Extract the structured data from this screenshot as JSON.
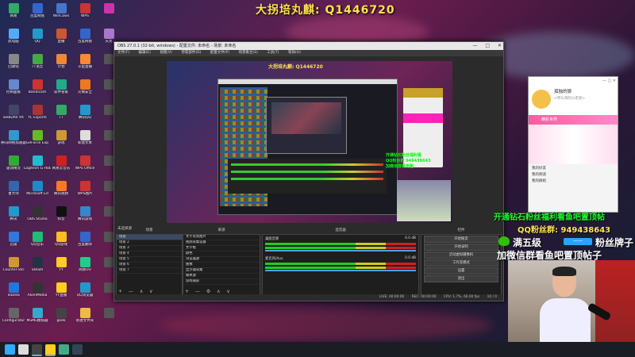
{
  "banner": "大拐培丸麒: Q1446720",
  "desktop_icons": [
    {
      "label": "网易",
      "color": "#3a6"
    },
    {
      "label": "百度网盘",
      "color": "#36c"
    },
    {
      "label": "WinCows",
      "color": "#47c"
    },
    {
      "label": "WPS",
      "color": "#c33"
    },
    {
      "label": "",
      "color": "#c3a"
    },
    {
      "label": "此电脑",
      "color": "#5af"
    },
    {
      "label": "QQ",
      "color": "#29c"
    },
    {
      "label": "直播",
      "color": "#c53"
    },
    {
      "label": "百度网盘",
      "color": "#36c"
    },
    {
      "label": "天龙",
      "color": "#a7c"
    },
    {
      "label": "回收站",
      "color": "#888"
    },
    {
      "label": "TT语音",
      "color": "#4a4"
    },
    {
      "label": "计划",
      "color": "#e83"
    },
    {
      "label": "斗鱼直播",
      "color": "#f83"
    },
    {
      "label": "",
      "color": "#555"
    },
    {
      "label": "控制面板",
      "color": "#68c"
    },
    {
      "label": "Bandicam",
      "color": "#c33"
    },
    {
      "label": "软件管家",
      "color": "#2a8"
    },
    {
      "label": "火绒安全",
      "color": "#e72"
    },
    {
      "label": "",
      "color": "#555"
    },
    {
      "label": "webDAV 9X",
      "color": "#446"
    },
    {
      "label": "YL Esports",
      "color": "#a33"
    },
    {
      "label": "TT",
      "color": "#3a6"
    },
    {
      "label": "腾讯QQ",
      "color": "#29c"
    },
    {
      "label": "",
      "color": "#555"
    },
    {
      "label": "腾讯网络加速器",
      "color": "#39c"
    },
    {
      "label": "GeForce Exp",
      "color": "#6b2"
    },
    {
      "label": "游戏",
      "color": "#c93"
    },
    {
      "label": "新建文本",
      "color": "#ddd"
    },
    {
      "label": "",
      "color": "#555"
    },
    {
      "label": "驱动精灵",
      "color": "#3a3"
    },
    {
      "label": "Logitech G HUB",
      "color": "#2bc"
    },
    {
      "label": "网易云音乐",
      "color": "#c22"
    },
    {
      "label": "WPS Office",
      "color": "#c33"
    },
    {
      "label": "",
      "color": "#555"
    },
    {
      "label": "鲁大师",
      "color": "#36a"
    },
    {
      "label": "Microsoft Ed",
      "color": "#28c"
    },
    {
      "label": "腾讯视频",
      "color": "#f72"
    },
    {
      "label": "WPS图片",
      "color": "#c33"
    },
    {
      "label": "",
      "color": "#555"
    },
    {
      "label": "腾讯",
      "color": "#29c"
    },
    {
      "label": "OBS Studio",
      "color": "#333"
    },
    {
      "label": "抖音",
      "color": "#111"
    },
    {
      "label": "腾讯游戏",
      "color": "#38c"
    },
    {
      "label": "",
      "color": "#555"
    },
    {
      "label": "迅雷",
      "color": "#37d"
    },
    {
      "label": "QQ音乐",
      "color": "#2b7"
    },
    {
      "label": "QQ游戏",
      "color": "#fb2"
    },
    {
      "label": "百度翻译",
      "color": "#36c"
    },
    {
      "label": "",
      "color": "#555"
    },
    {
      "label": "Counter-Stri",
      "color": "#c93"
    },
    {
      "label": "Steam",
      "color": "#234"
    },
    {
      "label": "YY",
      "color": "#fc2"
    },
    {
      "label": "网易UU",
      "color": "#2c8"
    },
    {
      "label": "",
      "color": "#555"
    },
    {
      "label": "ToDesk",
      "color": "#27d"
    },
    {
      "label": "AlienMedia",
      "color": "#333"
    },
    {
      "label": "YY直播",
      "color": "#fc2"
    },
    {
      "label": "QQ浏览器",
      "color": "#29c"
    },
    {
      "label": "",
      "color": "#555"
    },
    {
      "label": "Configurator",
      "color": "#666"
    },
    {
      "label": "MuMu模拟器",
      "color": "#3ac"
    },
    {
      "label": "geek",
      "color": "#444"
    },
    {
      "label": "新建文件夹",
      "color": "#eb4"
    },
    {
      "label": "",
      "color": "#555"
    }
  ],
  "obs": {
    "title": "OBS 27.0.1 (32-bit, windows) - 配置文件: 未命名 - 场景: 未命名",
    "window_controls": [
      "—",
      "□",
      "✕"
    ],
    "menu": [
      "文件(F)",
      "编辑(E)",
      "视图(V)",
      "停靠部件(D)",
      "配置文件(P)",
      "场景集合(S)",
      "工具(T)",
      "帮助(H)"
    ],
    "preview_banner": "大拐培丸麒: Q1446720",
    "preview_promo": [
      "开通钻石粉丝福利看",
      "QQ粉丝群 949438643",
      "加微信群看电脑"
    ],
    "preview_label": "未选择源",
    "docks": {
      "scenes": {
        "title": "场景",
        "items": [
          "场景",
          "场景 2",
          "场景 3",
          "场景 4",
          "场景 5",
          "场景 6",
          "场景 7"
        ],
        "selected": 0,
        "footer": "+ — ∧ ∨"
      },
      "sources": {
        "title": "来源",
        "items": [
          "文字背景图片",
          "视频采集设备",
          "文字框",
          "颜色",
          "浏览器源",
          "图像",
          "显示器采集",
          "媒体源",
          "游戏捕获"
        ],
        "footer": "+ — ⚙ ∧ ∨"
      },
      "mixer": {
        "title": "混音器",
        "channels": [
          {
            "name": "桌面音频",
            "db": "0.0 dB"
          },
          {
            "name": "麦克风/Aux",
            "db": "0.0 dB"
          }
        ]
      },
      "controls": {
        "title": "控件",
        "buttons": [
          "开始推流",
          "开始录制",
          "启动虚拟摄像机",
          "工作室模式",
          "设置",
          "退出"
        ]
      }
    },
    "status": [
      "LIVE: 00:00:00",
      "REC: 00:00:00",
      "CPU: 1.7%, 60.00 fps",
      "10 / 0"
    ]
  },
  "chat": {
    "name": "孤独的狼",
    "subtitle": "<带头哥的小老弟>",
    "window_controls": "— □ ✕",
    "promo": "精彩世界",
    "list": [
      "我的好友",
      "我的频道",
      "我的群组"
    ]
  },
  "overlay": {
    "line1": "开通钻石粉丝福利看鱼吧置顶帖",
    "line2": "QQ粉丝群: 949438643",
    "line3": "满五级",
    "line3_tag": "一一",
    "line3_end": "粉丝牌子",
    "line4": "加微信群看鱼吧置顶帖子"
  },
  "taskbar_icons": [
    {
      "name": "windows-start-icon",
      "color": "#3af"
    },
    {
      "name": "search-icon",
      "color": "#ddd"
    },
    {
      "name": "obs-taskbar-icon",
      "color": "#444",
      "active": true
    },
    {
      "name": "yy-taskbar-icon",
      "color": "#fc2",
      "active": true
    },
    {
      "name": "chrome-taskbar-icon",
      "color": "#4a8"
    },
    {
      "name": "steam-taskbar-icon",
      "color": "#345"
    }
  ]
}
